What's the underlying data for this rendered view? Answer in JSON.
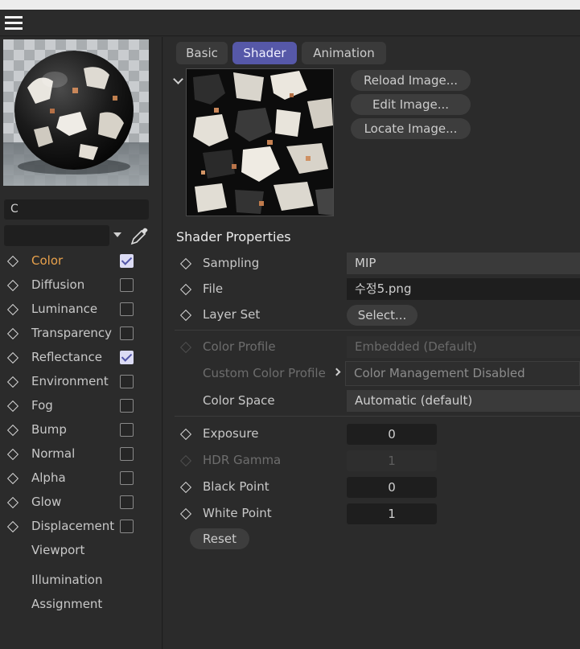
{
  "colors": {
    "accent_tab": "#5658a8",
    "active_channel": "#e8a14c",
    "checkbox_on": "#dcdcf4"
  },
  "icons": [
    "menu-icon",
    "dropdown-arrow-icon",
    "eyedropper-icon",
    "diamond-keyframe-icon",
    "checkbox-icon",
    "chevron-down-icon",
    "chevron-right-icon"
  ],
  "material": {
    "name": "C"
  },
  "channels": [
    {
      "label": "Color",
      "checked": true,
      "active": true
    },
    {
      "label": "Diffusion",
      "checked": false
    },
    {
      "label": "Luminance",
      "checked": false
    },
    {
      "label": "Transparency",
      "checked": false
    },
    {
      "label": "Reflectance",
      "checked": true
    },
    {
      "label": "Environment",
      "checked": false
    },
    {
      "label": "Fog",
      "checked": false
    },
    {
      "label": "Bump",
      "checked": false
    },
    {
      "label": "Normal",
      "checked": false
    },
    {
      "label": "Alpha",
      "checked": false
    },
    {
      "label": "Glow",
      "checked": false
    },
    {
      "label": "Displacement",
      "checked": false
    }
  ],
  "extra_items": [
    "Viewport",
    "Illumination",
    "Assignment"
  ],
  "tabs": [
    {
      "label": "Basic",
      "active": false
    },
    {
      "label": "Shader",
      "active": true
    },
    {
      "label": "Animation",
      "active": false
    }
  ],
  "image_buttons": [
    "Reload Image...",
    "Edit Image...",
    "Locate Image..."
  ],
  "shader": {
    "title": "Shader Properties",
    "sampling_label": "Sampling",
    "sampling_value": "MIP",
    "file_label": "File",
    "file_value": "수정5.png",
    "layerset_label": "Layer Set",
    "layerset_button": "Select...",
    "color_profile_label": "Color Profile",
    "color_profile_value": "Embedded (Default)",
    "custom_profile_label": "Custom Color Profile",
    "custom_profile_value": "Color Management Disabled",
    "color_space_label": "Color Space",
    "color_space_value": "Automatic (default)",
    "exposure_label": "Exposure",
    "exposure_value": "0",
    "hdr_gamma_label": "HDR Gamma",
    "hdr_gamma_value": "1",
    "black_point_label": "Black Point",
    "black_point_value": "0",
    "white_point_label": "White Point",
    "white_point_value": "1",
    "reset_label": "Reset"
  }
}
